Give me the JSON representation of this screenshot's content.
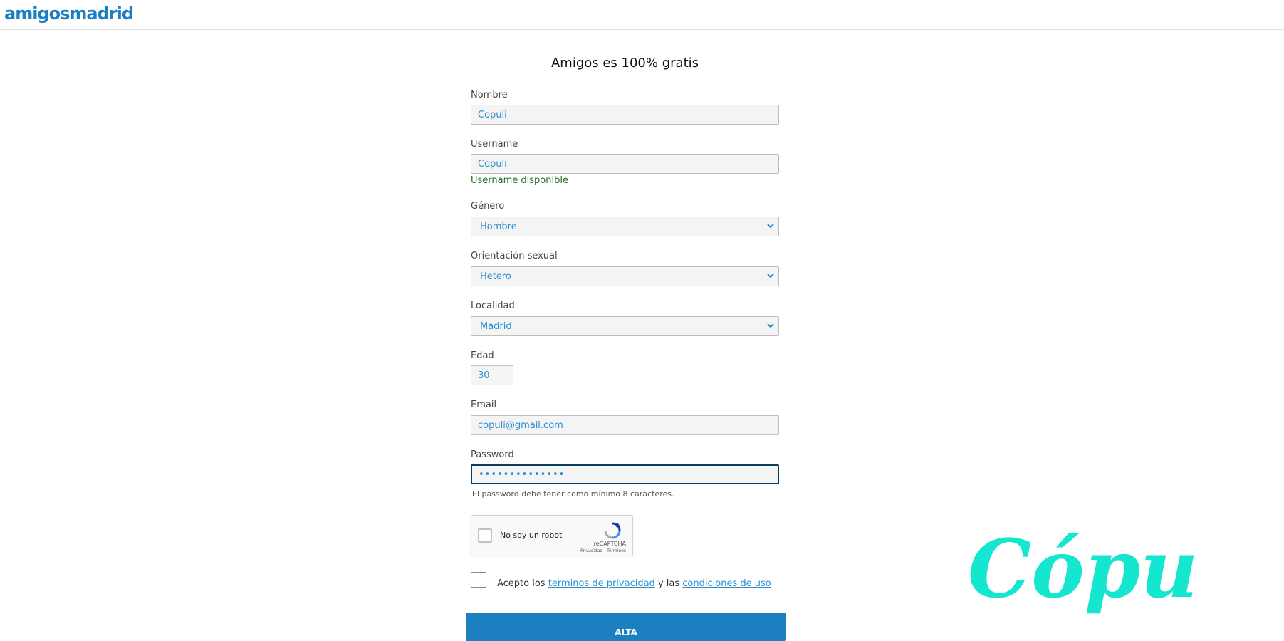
{
  "header": {
    "logo_text": "amigosmadrid"
  },
  "form": {
    "title": "Amigos es 100% gratis",
    "nombre": {
      "label": "Nombre",
      "value": "Copuli"
    },
    "username": {
      "label": "Username",
      "value": "Copuli",
      "status": "Username disponible"
    },
    "genero": {
      "label": "Género",
      "selected": "Hombre"
    },
    "orientacion": {
      "label": "Orientación sexual",
      "selected": "Hetero"
    },
    "localidad": {
      "label": "Localidad",
      "selected": "Madrid"
    },
    "edad": {
      "label": "Edad",
      "value": "30"
    },
    "email": {
      "label": "Email",
      "value": "copuli@gmail.com"
    },
    "password": {
      "label": "Password",
      "value": "••••••••••••••",
      "hint": "El password debe tener como mínimo 8 caracteres."
    },
    "captcha": {
      "label": "No soy un robot",
      "brand": "reCAPTCHA",
      "links": "Privacidad - Términos"
    },
    "terms": {
      "prefix": "Acepto los",
      "privacy_link": "terminos de privacidad",
      "middle": "y las",
      "conditions_link": "condiciones de uso"
    },
    "submit_label": "ALTA"
  },
  "watermark": {
    "text": "Cópuli"
  },
  "colors": {
    "brand_blue": "#1b7fc0",
    "input_text": "#2a8fd0",
    "success_green": "#1e6d1e",
    "watermark_teal": "#14e6cf"
  }
}
